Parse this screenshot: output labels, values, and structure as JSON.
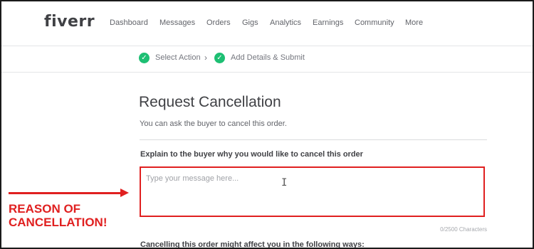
{
  "nav": {
    "logo": "fiverr",
    "items": [
      "Dashboard",
      "Messages",
      "Orders",
      "Gigs",
      "Analytics",
      "Earnings",
      "Community",
      "More"
    ]
  },
  "steps": {
    "step1": "Select Action",
    "separator": "›",
    "step2": "Add Details & Submit"
  },
  "main": {
    "title": "Request Cancellation",
    "subtitle": "You can ask the buyer to cancel this order.",
    "question": "Explain to the buyer why you would like to cancel this order",
    "placeholder": "Type your message here...",
    "char_count": "0/2500 Characters",
    "affect_heading": "Cancelling this order might affect you in the following ways:"
  },
  "annotation": {
    "line1": "REASON OF",
    "line2": "CANCELLATION!"
  },
  "colors": {
    "accent_green": "#1dbf73",
    "annotation_red": "#e02020"
  }
}
